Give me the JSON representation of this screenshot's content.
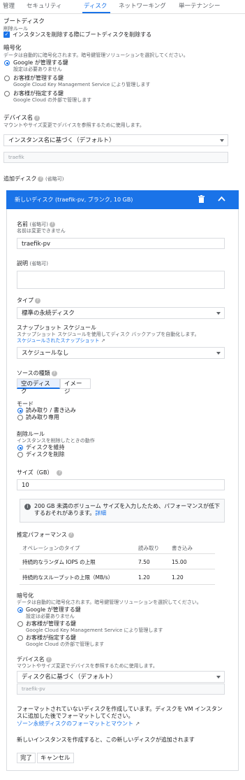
{
  "tabs": [
    "管理",
    "セキュリティ",
    "ディスク",
    "ネットワーキング",
    "単一テナンシー"
  ],
  "boot": {
    "title": "ブートディスク",
    "deletion_rule_label": "削除ルール",
    "delete_checkbox": "インスタンスを削除する際にブートディスクを削除する"
  },
  "encryption": {
    "title": "暗号化",
    "desc": "データは自動的に暗号化されます。暗号鍵管理ソリューションを選択してください。",
    "options": [
      {
        "label": "Google が管理する鍵",
        "sub": "設定は必要ありません"
      },
      {
        "label": "お客様が管理する鍵",
        "sub": "Google Cloud Key Management Service により管理します"
      },
      {
        "label": "お客様が指定する鍵",
        "sub": "Google Cloud の外部で管理します"
      }
    ]
  },
  "device_name": {
    "title": "デバイス名",
    "desc": "マウントやサイズ変更でデバイスを参照するために使用します。",
    "select_value": "インスタンス名に基づく（デフォルト）",
    "value": "traefik"
  },
  "additional_disk": {
    "title": "追加ディスク",
    "optional": "(省略可)"
  },
  "new_disk": {
    "header": "新しいディスク (traefik-pv, ブランク, 10 GB)",
    "name_label": "名前",
    "name_optional": "(省略可)",
    "name_desc": "名前は変更できません",
    "name_value": "traefik-pv",
    "desc_label": "説明",
    "desc_optional": "(省略可)",
    "type_label": "タイプ",
    "type_value": "標準の永続ディスク",
    "snapshot_label": "スナップショット スケジュール",
    "snapshot_desc": "スナップショット スケジュールを使用してディスク バックアップを自動化します。",
    "snapshot_link": "スケジュールされたスナップショット",
    "snapshot_value": "スケジュールなし",
    "source_label": "ソースの種類",
    "source_options": [
      "空のディスク",
      "イメージ"
    ],
    "mode_label": "モード",
    "mode_options": [
      "読み取り / 書き込み",
      "読み取り専用"
    ],
    "deletion_label": "削除ルール",
    "deletion_desc": "インスタンスを削除したときの動作",
    "deletion_options": [
      "ディスクを維持",
      "ディスクを削除"
    ],
    "size_label": "サイズ（GB）",
    "size_value": "10",
    "info_text": "200 GB 未満のボリューム サイズを入力したため、パフォーマンスが低下するおそれがあります。",
    "info_link": "詳細",
    "perf_title": "推定パフォーマンス",
    "perf_headers": [
      "オペレーションのタイプ",
      "読み取り",
      "書き込み"
    ],
    "perf_rows": [
      {
        "type": "持続的なランダム IOPS の上限",
        "read": "7.50",
        "write": "15.00"
      },
      {
        "type": "持続的なスループットの上限（MB/s）",
        "read": "1.20",
        "write": "1.20"
      }
    ],
    "enc_title": "暗号化",
    "enc_desc": "データは自動的に暗号化されます。暗号鍵管理ソリューションを選択してください。",
    "enc_options": [
      {
        "label": "Google が管理する鍵",
        "sub": "設定は必要ありません"
      },
      {
        "label": "お客様が管理する鍵",
        "sub": "Google Cloud Key Management Service により管理します"
      },
      {
        "label": "お客様が指定する鍵",
        "sub": "Google Cloud の外部で管理します"
      }
    ],
    "dev_title": "デバイス名",
    "dev_desc": "マウントやサイズ変更でデバイスを参照するために使用します。",
    "dev_select": "ディスク名に基づく（デフォルト）",
    "dev_value": "traefik-pv",
    "format_note": "フォーマットされていないディスクを作成しています。ディスクを VM インスタンスに追加した後でフォーマットしてください。",
    "format_link": "ゾーン永続ディスクのフォーマットとマウント",
    "new_instance_note": "新しいインスタンスを作成すると、この新しいディスクが追加されます",
    "done_button": "完了",
    "cancel_button": "キャンセル"
  },
  "colors": {
    "accent": "#1a73e8",
    "border": "#dadce0",
    "muted": "#5f6368"
  }
}
